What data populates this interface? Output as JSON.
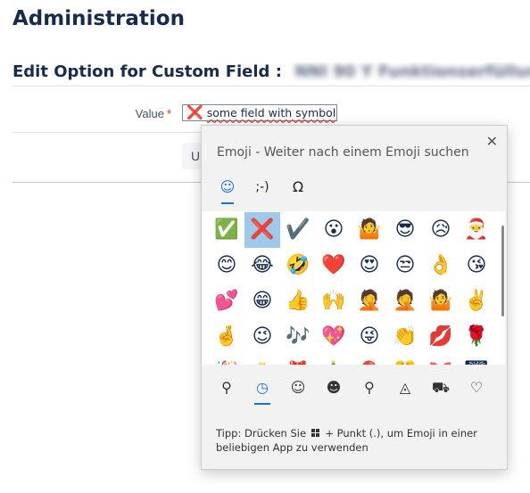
{
  "page": {
    "title": "Administration",
    "section_title": "Edit Option for Custom Field :",
    "blurred_field_name": "NNI 90 Y Funktionserfüllung"
  },
  "form": {
    "value_label": "Value",
    "required_marker": "*",
    "value_glyph": "❌",
    "value_text": "some field with symbol",
    "update_label": "Up"
  },
  "emoji_panel": {
    "header": "Emoji - Weiter nach einem Emoji suchen",
    "close_glyph": "✕",
    "category_tabs": [
      {
        "glyph": "☺",
        "name": "emoji",
        "active": true
      },
      {
        "glyph": ";-)",
        "name": "kaomoji",
        "active": false
      },
      {
        "glyph": "Ω",
        "name": "symbols",
        "active": false
      }
    ],
    "emojis": [
      "✅",
      "❌",
      "✔️",
      "😮",
      "🤷",
      "😎",
      "😥",
      "🎅",
      "😊",
      "😂",
      "🤣",
      "❤️",
      "😍",
      "😒",
      "👌",
      "😘",
      "💕",
      "😁",
      "👍",
      "🙌",
      "🤦",
      "🤦",
      "🤷",
      "✌️",
      "🤞",
      "😉",
      "🎶",
      "💖",
      "😜",
      "👏",
      "💋",
      "🌹",
      "🎉",
      "🎂",
      "🎁",
      "🎄",
      "🎈",
      "🎊",
      "🎀",
      "🎆"
    ],
    "selected_index": 1,
    "bottom_tabs": [
      {
        "glyph": "⚲",
        "name": "search",
        "active": false
      },
      {
        "glyph": "◷",
        "name": "recent",
        "active": true
      },
      {
        "glyph": "☺",
        "name": "smileys",
        "active": false
      },
      {
        "glyph": "☻",
        "name": "people",
        "active": false
      },
      {
        "glyph": "⚲",
        "name": "celebration",
        "active": false
      },
      {
        "glyph": "◬",
        "name": "food",
        "active": false
      },
      {
        "glyph": "⛟",
        "name": "travel",
        "active": false
      },
      {
        "glyph": "♡",
        "name": "symbols",
        "active": false
      }
    ],
    "tip_prefix": "Tipp: Drücken Sie",
    "tip_suffix": "+ Punkt (.), um Emoji in einer beliebigen App zu verwenden"
  },
  "colors": {
    "selected_bg": "#9fc9ea",
    "accent": "#1a73c8",
    "required": "#de350b"
  }
}
